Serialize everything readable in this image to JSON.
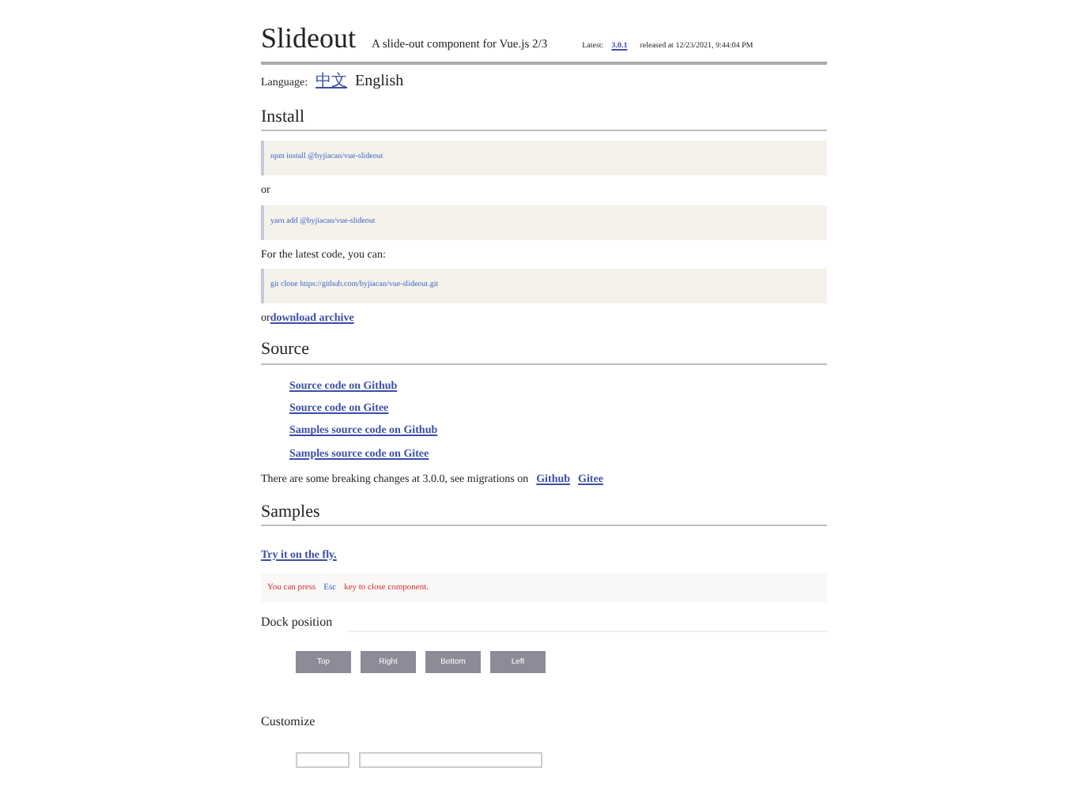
{
  "header": {
    "title": "Slideout",
    "subtitle": "A slide-out component for Vue.js 2/3",
    "latest_label": "Latest:",
    "version": "3.0.1",
    "released": "released at 12/23/2021, 9:44:04 PM"
  },
  "language": {
    "label": "Language:",
    "options": [
      {
        "label": "中文",
        "selected": false
      },
      {
        "label": "English",
        "selected": true
      }
    ]
  },
  "install": {
    "heading": "Install",
    "items": [
      {
        "kind": "code",
        "text": "npm install @byjiacan/vue-slideout"
      },
      {
        "kind": "text",
        "text": "or"
      },
      {
        "kind": "code",
        "text": "yarn add @byjiacan/vue-slideout"
      },
      {
        "kind": "text",
        "text": "For the latest code, you can:"
      },
      {
        "kind": "code",
        "text": "git clone https://github.com/byjiacan/vue-slideout.git"
      },
      {
        "kind": "link",
        "prefix": "or",
        "link": "download archive"
      }
    ]
  },
  "source": {
    "heading": "Source",
    "links": [
      "Source code on Github",
      "Source code on Gitee",
      "Samples source code on Github",
      "Samples source code on Gitee"
    ],
    "note": "There are some breaking changes at 3.0.0, see migrations on",
    "note_links": [
      "Github",
      "Gitee"
    ]
  },
  "samples": {
    "heading": "Samples",
    "try_link": "Try it on the fly.",
    "tip_before": "You can press",
    "tip_key": "Esc",
    "tip_after": "key to close component.",
    "dock": {
      "heading": "Dock position",
      "buttons": [
        "Top",
        "Right",
        "Bottom",
        "Left"
      ]
    },
    "customize": {
      "heading": "Customize"
    }
  }
}
